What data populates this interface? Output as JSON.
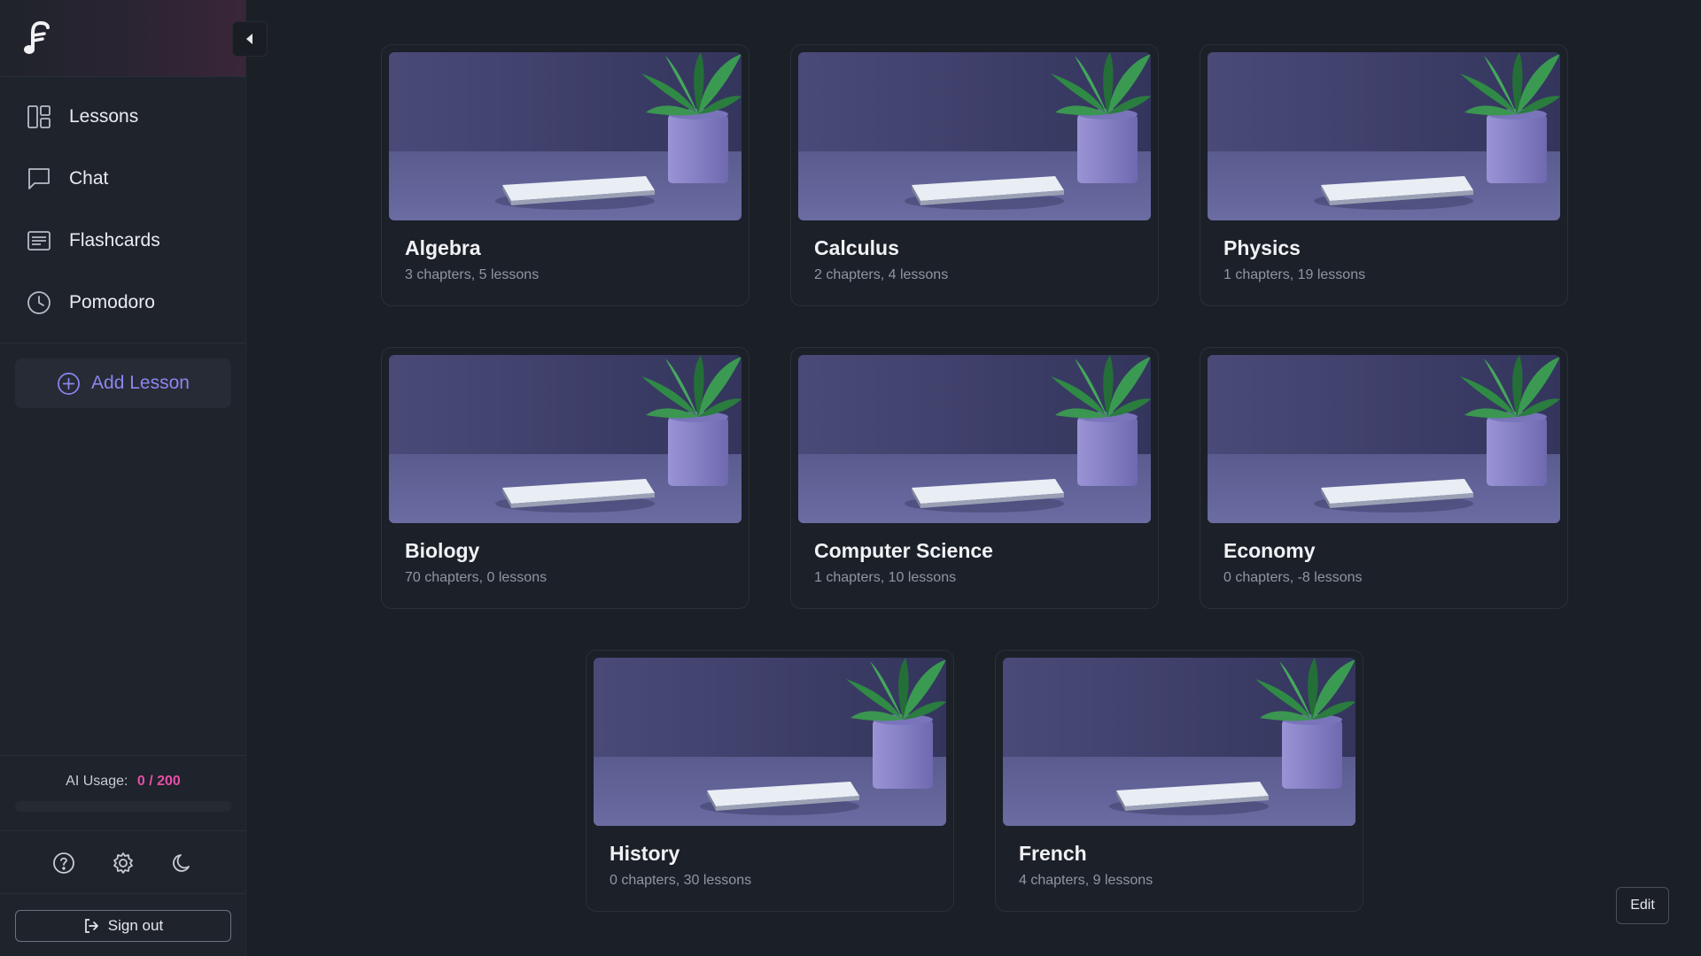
{
  "sidebar": {
    "collapse_icon": "caret-left-icon",
    "items": [
      {
        "label": "Lessons",
        "icon": "layout-icon"
      },
      {
        "label": "Chat",
        "icon": "chat-icon"
      },
      {
        "label": "Flashcards",
        "icon": "flashcards-icon"
      },
      {
        "label": "Pomodoro",
        "icon": "clock-icon"
      }
    ],
    "add_lesson_label": "Add Lesson",
    "usage": {
      "label": "AI Usage:",
      "value": "0 / 200",
      "fraction": 0
    },
    "bottom_icons": [
      "help-icon",
      "settings-icon",
      "dark-mode-icon"
    ],
    "signout_label": "Sign out"
  },
  "lessons": [
    {
      "title": "Algebra",
      "subtitle": "3 chapters, 5 lessons"
    },
    {
      "title": "Calculus",
      "subtitle": "2 chapters, 4 lessons"
    },
    {
      "title": "Physics",
      "subtitle": "1 chapters, 19 lessons"
    },
    {
      "title": "Biology",
      "subtitle": "70 chapters, 0 lessons"
    },
    {
      "title": "Computer Science",
      "subtitle": "1 chapters, 10 lessons"
    },
    {
      "title": "Economy",
      "subtitle": "0 chapters, -8 lessons"
    },
    {
      "title": "History",
      "subtitle": "0 chapters, 30 lessons"
    },
    {
      "title": "French",
      "subtitle": "4 chapters, 9 lessons"
    }
  ],
  "edit_label": "Edit",
  "colors": {
    "accent": "#8b86f0",
    "usage": "#e44fa6",
    "background": "#1b1f26"
  }
}
